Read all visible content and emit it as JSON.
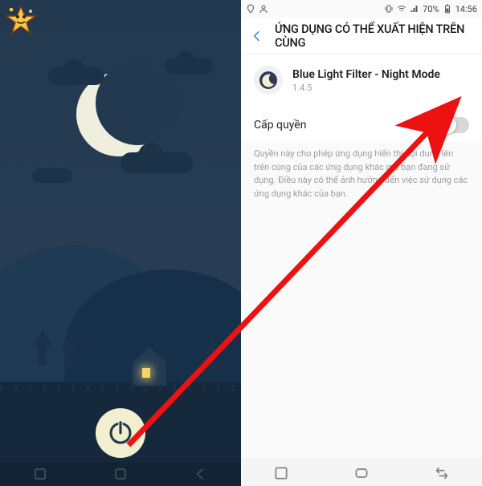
{
  "left": {
    "app_decor_name": "night-scene",
    "power_button_label": "power"
  },
  "right": {
    "statusbar": {
      "battery": "70%",
      "time": "14:56"
    },
    "header": {
      "title": "ỨNG DỤNG CÓ THỂ XUẤT HIỆN TRÊN CÙNG"
    },
    "app": {
      "name": "Blue Light Filter - Night Mode",
      "version": "1.4.5"
    },
    "permission": {
      "label": "Cấp quyền",
      "enabled": false
    },
    "description": "Quyền này cho phép ứng dụng hiển thị nội dung lên trên cùng của các ứng dụng khác mà bạn đang sử dụng. Điều này có thể ảnh hưởng đến việc sử dụng các ứng dụng khác của bạn."
  }
}
